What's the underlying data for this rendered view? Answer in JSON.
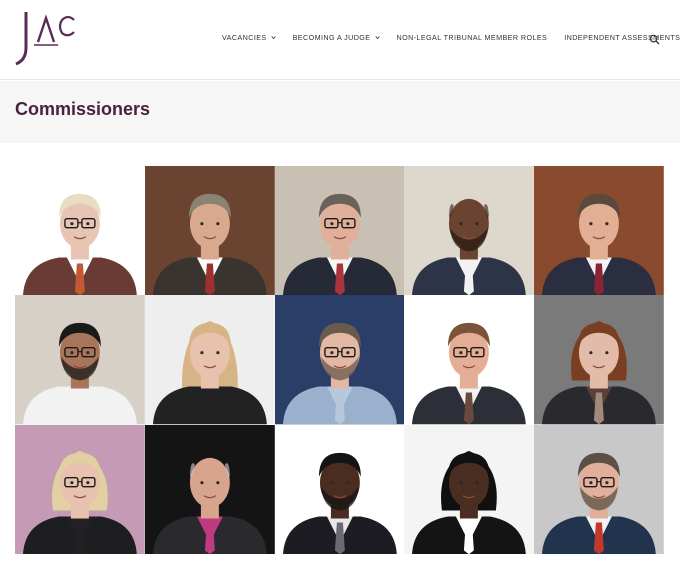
{
  "brand": {
    "logo_text": "JAC",
    "accent": "#5b2a56"
  },
  "nav": {
    "items": [
      {
        "label": "VACANCIES",
        "has_dropdown": true
      },
      {
        "label": "BECOMING A JUDGE",
        "has_dropdown": true
      },
      {
        "label": "NON-LEGAL TRIBUNAL MEMBER ROLES",
        "has_dropdown": false
      },
      {
        "label": "INDEPENDENT ASSESSMENTS",
        "has_dropdown": false
      }
    ],
    "search_icon": "search-icon"
  },
  "page": {
    "title": "Commissioners"
  },
  "commissioners": [
    {
      "bg": "#ffffff",
      "skin": "#e8c4b4",
      "hair": "#e8dcc4",
      "hair_style": "short",
      "shirt": "#ffffff",
      "jacket": "#6a3a34",
      "accent": "#c05a34",
      "glasses": true,
      "beard": false
    },
    {
      "bg": "#6a4430",
      "skin": "#d9a98e",
      "hair": "#8a8272",
      "hair_style": "swept",
      "shirt": "#ffffff",
      "jacket": "#3a3430",
      "accent": "#a03030",
      "glasses": false,
      "beard": false
    },
    {
      "bg": "#c8c0b2",
      "skin": "#e0b09a",
      "hair": "#6a625a",
      "hair_style": "short",
      "shirt": "#f6f6f6",
      "jacket": "#262a36",
      "accent": "#a8343e",
      "glasses": true,
      "beard": false
    },
    {
      "bg": "#ddd7cc",
      "skin": "#6a4430",
      "hair": "#2a1a14",
      "hair_style": "bald",
      "shirt": "#f2f2f2",
      "jacket": "#2e3448",
      "accent": "#f2f2f2",
      "glasses": false,
      "beard": true
    },
    {
      "bg": "#8a4a2e",
      "skin": "#e2ae94",
      "hair": "#5a4a3e",
      "hair_style": "short",
      "shirt": "#f4f4f4",
      "jacket": "#2a2e40",
      "accent": "#8a2434",
      "glasses": false,
      "beard": false
    },
    {
      "bg": "#d6d0c6",
      "skin": "#a8745a",
      "hair": "#1a1a1a",
      "hair_style": "short",
      "shirt": "#f2f2f2",
      "jacket": "#f2f2f2",
      "accent": "#f2f2f2",
      "glasses": true,
      "beard": true
    },
    {
      "bg": "#eeeeee",
      "skin": "#e8c2ac",
      "hair": "#d6b486",
      "hair_style": "long",
      "shirt": "#222222",
      "jacket": "#222222",
      "accent": "#222222",
      "glasses": false,
      "beard": false
    },
    {
      "bg": "#2a3e68",
      "skin": "#e2b8a2",
      "hair": "#6a5a4e",
      "hair_style": "short",
      "shirt": "#b8c8dc",
      "jacket": "#9ab0cc",
      "accent": "#b8c8dc",
      "glasses": true,
      "beard": true
    },
    {
      "bg": "#ffffff",
      "skin": "#e4ae96",
      "hair": "#7a5438",
      "hair_style": "short",
      "shirt": "#f2f2f2",
      "jacket": "#2c2e38",
      "accent": "#6a4a3e",
      "glasses": true,
      "beard": false
    },
    {
      "bg": "#7a7a7a",
      "skin": "#e2bca8",
      "hair": "#7a3e22",
      "hair_style": "bob",
      "shirt": "#5a4038",
      "jacket": "#2a2a2e",
      "accent": "#a08a7a",
      "glasses": false,
      "beard": false
    },
    {
      "bg": "#c49ab4",
      "skin": "#e8c2ae",
      "hair": "#e0d0a2",
      "hair_style": "bob",
      "shirt": "#222222",
      "jacket": "#1e1e22",
      "accent": "#222222",
      "glasses": true,
      "beard": false
    },
    {
      "bg": "#141414",
      "skin": "#d8a48e",
      "hair": "#d8d8d8",
      "hair_style": "bald",
      "shirt": "#c03a82",
      "jacket": "#2a2a2e",
      "accent": "#c03a82",
      "glasses": false,
      "beard": false
    },
    {
      "bg": "#ffffff",
      "skin": "#4a2c20",
      "hair": "#141414",
      "hair_style": "short",
      "shirt": "#e8e8e8",
      "jacket": "#1c1c22",
      "accent": "#6a6a74",
      "glasses": false,
      "beard": true
    },
    {
      "bg": "#f4f4f4",
      "skin": "#4a2e22",
      "hair": "#101010",
      "hair_style": "bob",
      "shirt": "#ffffff",
      "jacket": "#141414",
      "accent": "#ffffff",
      "glasses": false,
      "beard": false
    },
    {
      "bg": "#c8c8c8",
      "skin": "#e2b09a",
      "hair": "#5a5046",
      "hair_style": "short",
      "shirt": "#f2f2f2",
      "jacket": "#22334e",
      "accent": "#c0392b",
      "glasses": true,
      "beard": true
    }
  ]
}
